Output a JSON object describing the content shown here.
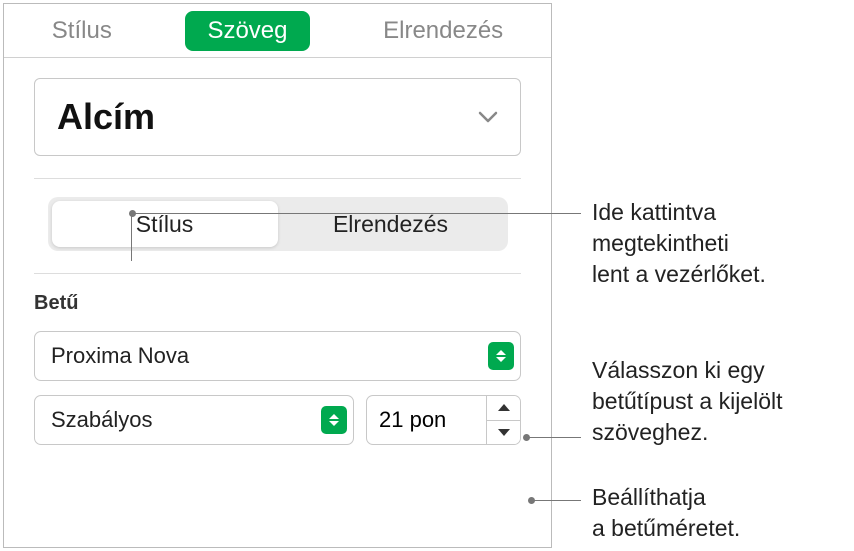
{
  "tabs": {
    "style": "Stílus",
    "text": "Szöveg",
    "layout": "Elrendezés"
  },
  "paragraph_style": {
    "current": "Alcím"
  },
  "subtabs": {
    "style": "Stílus",
    "layout": "Elrendezés"
  },
  "font": {
    "section_label": "Betű",
    "family": "Proxima Nova",
    "weight": "Szabályos",
    "size_text": "21 pon"
  },
  "callouts": {
    "c1_l1": "Ide kattintva",
    "c1_l2": "megtekintheti",
    "c1_l3": "lent a vezérlőket.",
    "c2_l1": "Válasszon ki egy",
    "c2_l2": "betűtípust a kijelölt",
    "c2_l3": "szöveghez.",
    "c3_l1": "Beállíthatja",
    "c3_l2": "a betűméretet."
  }
}
